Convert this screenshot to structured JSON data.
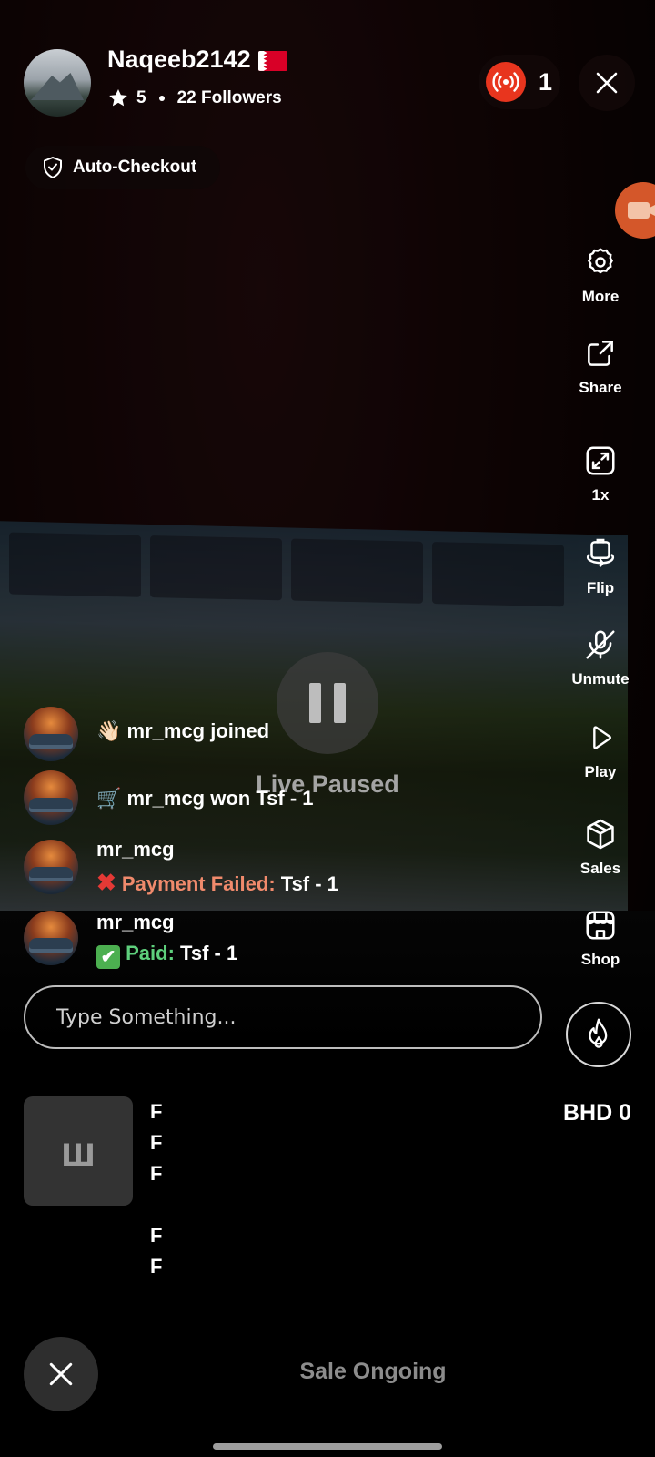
{
  "header": {
    "username": "Naqeeb2142",
    "rating": "5",
    "followers": "22 Followers",
    "viewer_count": "1"
  },
  "auto_checkout": {
    "label": "Auto-Checkout"
  },
  "rail": [
    {
      "label": "More",
      "icon": "gear-icon"
    },
    {
      "label": "Share",
      "icon": "share-icon"
    },
    {
      "label": "1x",
      "icon": "expand-icon"
    },
    {
      "label": "Flip",
      "icon": "flip-camera-icon"
    },
    {
      "label": "Unmute",
      "icon": "mic-off-icon"
    },
    {
      "label": "Play",
      "icon": "play-icon"
    },
    {
      "label": "Sales",
      "icon": "box-icon"
    },
    {
      "label": "Shop",
      "icon": "store-icon"
    }
  ],
  "stream": {
    "status": "Live Paused"
  },
  "chat": [
    {
      "text": "mr_mcg joined",
      "emoji": "👋🏻"
    },
    {
      "text": "mr_mcg won Tsf - 1",
      "emoji": "🛒"
    },
    {
      "user": "mr_mcg",
      "status_label": "Payment Failed:",
      "item": "Tsf - 1"
    },
    {
      "user": "mr_mcg",
      "status_label": "Paid:",
      "item": "Tsf - 1"
    }
  ],
  "composer": {
    "placeholder": "Type Something..."
  },
  "product": {
    "thumb_text": "ш",
    "lines": [
      "F",
      "F",
      "F",
      "F",
      "F"
    ],
    "price": "BHD 0"
  },
  "footer": {
    "status": "Sale Ongoing"
  },
  "colors": {
    "live": "#e8351e",
    "fail": "#f08a6c",
    "paid": "#5ecf7c",
    "camera": "#d4572a"
  }
}
